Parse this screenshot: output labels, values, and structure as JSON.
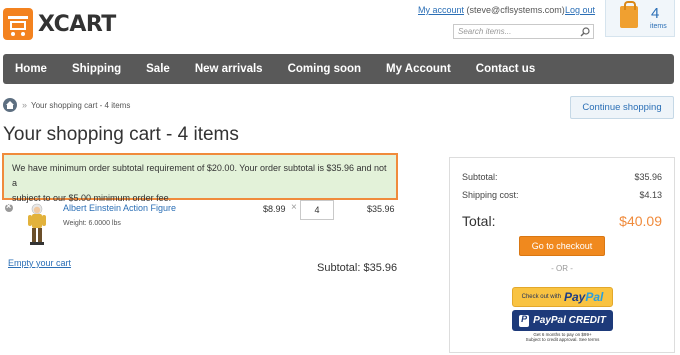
{
  "header": {
    "logo_text": "XCART",
    "my_account_link": "My account",
    "account_email": "(steve@cflsystems.com)",
    "logout": "Log out",
    "search_placeholder": "Search items...",
    "cart_count": "4",
    "cart_count_label": "items"
  },
  "nav": {
    "items": [
      "Home",
      "Shipping",
      "Sale",
      "New arrivals",
      "Coming soon",
      "My Account",
      "Contact us"
    ]
  },
  "breadcrumb": {
    "separator": "»",
    "current": "Your shopping cart - 4 items"
  },
  "continue_shopping": "Continue shopping",
  "page_title": "Your shopping cart - 4 items",
  "notice": {
    "line1": "We have minimum order subtotal requirement of $20.00. Your order subtotal is $35.96 and not a",
    "line2": "subject to our $5.00 minimum order fee."
  },
  "cart_item": {
    "name": "Albert Einstein Action Figure",
    "weight": "Weight: 6.0000 lbs",
    "price": "$8.99",
    "times": "×",
    "quantity": "4",
    "total": "$35.96"
  },
  "empty_cart": "Empty your cart",
  "subtotal_line": "Subtotal: $35.96",
  "summary": {
    "subtotal_label": "Subtotal:",
    "subtotal_value": "$35.96",
    "shipping_label": "Shipping cost:",
    "shipping_value": "$4.13",
    "total_label": "Total:",
    "total_value": "$40.09",
    "checkout": "Go to checkout",
    "or": "- OR -",
    "paypal_prefix": "Check out with",
    "paypal_logo_a": "Pay",
    "paypal_logo_b": "Pal",
    "paypal_credit": "PayPal CREDIT",
    "paypal_credit_note1": "Get 6 months to pay on $99+",
    "paypal_credit_note2": "Subject to credit approval. See terms"
  },
  "colors": {
    "accent": "#f08b3c",
    "link": "#2b6fb6",
    "nav_bg": "#595959",
    "notice_bg": "#e3f2d9"
  }
}
